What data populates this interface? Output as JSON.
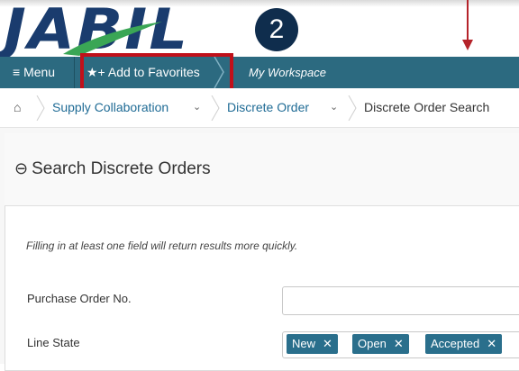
{
  "logo": {
    "text": "JABIL"
  },
  "step_badge": "2",
  "navbar": {
    "menu_icon": "≡",
    "menu_label": "Menu",
    "favorites_icon": "★+",
    "favorites_label": "Add to Favorites",
    "workspace_label": "My Workspace"
  },
  "breadcrumb": {
    "home_icon": "⌂",
    "items": [
      {
        "label": "Supply Collaboration"
      },
      {
        "label": "Discrete Order"
      },
      {
        "label": "Discrete Order Search"
      }
    ],
    "caret": "⌄"
  },
  "panel": {
    "collapse_icon": "⊖",
    "title": "Search Discrete Orders",
    "hint": "Filling in at least one field will return results more quickly."
  },
  "fields": {
    "po_label": "Purchase Order No.",
    "po_value": "",
    "line_state_label": "Line State",
    "line_state_chips": [
      "New",
      "Open",
      "Accepted"
    ],
    "chip_remove": "✕"
  },
  "colors": {
    "navbar": "#2c6a80",
    "link": "#1f6b95",
    "highlight": "#c0101a",
    "chip": "#2a6f8c",
    "logo": "#1a3c6e",
    "swoosh": "#3aa655"
  }
}
